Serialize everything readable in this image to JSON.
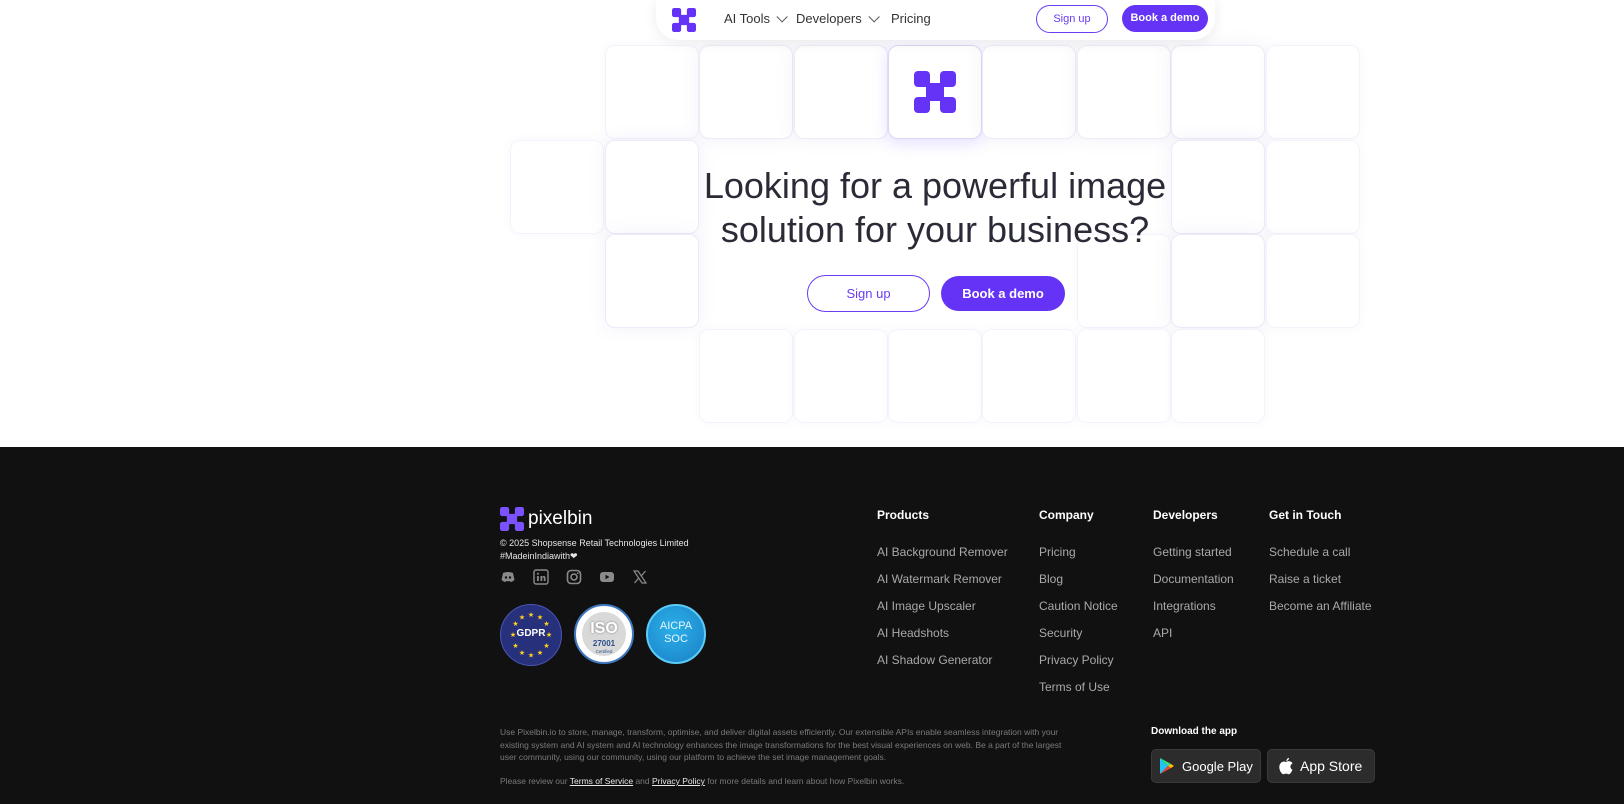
{
  "nav": {
    "items": [
      {
        "label": "AI Tools"
      },
      {
        "label": "Developers"
      },
      {
        "label": "Pricing"
      }
    ],
    "signup": "Sign up",
    "demo": "Book a demo"
  },
  "hero": {
    "headline_line1": "Looking for a powerful image",
    "headline_line2": "solution for your business?",
    "signup": "Sign up",
    "demo": "Book a demo"
  },
  "footer": {
    "brand": "pixelbin",
    "copyright": "© 2025 Shopsense Retail Technologies Limited",
    "made_in": "#MadeinIndiawith❤",
    "socials": [
      "discord-icon",
      "linkedin-icon",
      "instagram-icon",
      "youtube-icon",
      "x-icon"
    ],
    "badges": {
      "gdpr": "GDPR",
      "iso": "ISO",
      "iso_number": "27001",
      "iso_certified": "Certified",
      "aicpa_line1": "AICPA",
      "aicpa_line2": "SOC"
    },
    "columns": [
      {
        "title": "Products",
        "links": [
          "AI Background Remover",
          "AI Watermark Remover",
          "AI Image Upscaler",
          "AI Headshots",
          "AI Shadow Generator"
        ]
      },
      {
        "title": "Company",
        "links": [
          "Pricing",
          "Blog",
          "Caution Notice",
          "Security",
          "Privacy Policy",
          "Terms of Use"
        ]
      },
      {
        "title": "Developers",
        "links": [
          "Getting started",
          "Documentation",
          "Integrations",
          "API"
        ]
      },
      {
        "title": "Get in Touch",
        "links": [
          "Schedule a call",
          "Raise a ticket",
          "Become an Affiliate"
        ]
      }
    ],
    "about": "Use Pixelbin.io to store, manage, transform, optimise, and deliver digital assets efficiently. Our extensible APIs enable seamless integration with your existing system and AI system and AI technology enhances the image transformations for the best visual experiences on web. Be a part of the largest user community, using our community, using our platform to achieve the set image management goals.",
    "review": {
      "prefix": "Please review our ",
      "terms": "Terms of Service",
      "and": " and ",
      "privacy": " Privacy Policy",
      "suffix": " for more details and learn about how Pixelbin works."
    },
    "download": {
      "title": "Download the app",
      "google_play": "Google Play",
      "app_store": "App Store"
    }
  },
  "colors": {
    "accent": "#6433f5",
    "footer_bg": "#111111"
  }
}
